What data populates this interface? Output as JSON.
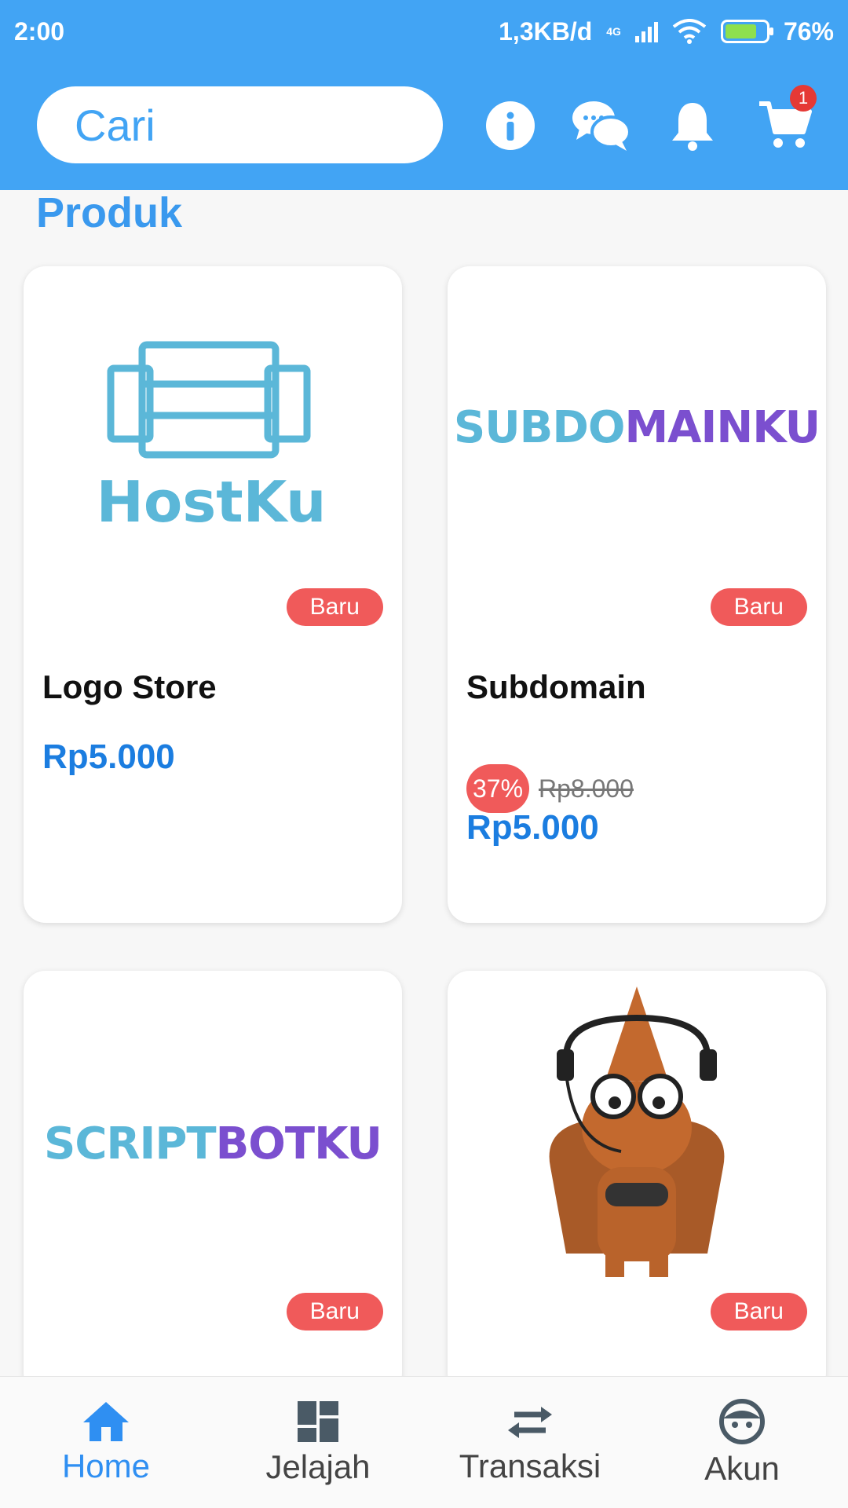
{
  "statusbar": {
    "time": "2:00",
    "speed": "1,3KB/d",
    "network": "4G",
    "battery": "76%"
  },
  "header": {
    "search_placeholder": "Cari",
    "cart_count": "1",
    "icons": [
      "info-icon",
      "chat-icon",
      "bell-icon",
      "cart-icon"
    ]
  },
  "section": {
    "title": "Produk"
  },
  "products": [
    {
      "name": "Logo Store",
      "price": "Rp5.000",
      "badge": "Baru",
      "logo_text": "HostKu"
    },
    {
      "name": "Subdomain",
      "price": "Rp5.000",
      "badge": "Baru",
      "discount": "37%",
      "old_price": "Rp8.000",
      "logo_text_a": "SUBDO",
      "logo_text_b": "MAINKU"
    },
    {
      "badge": "Baru",
      "logo_text_a": "SCRIPT",
      "logo_text_b": "BOTKU"
    },
    {
      "badge": "Baru"
    }
  ],
  "nav": [
    {
      "label": "Home",
      "active": true
    },
    {
      "label": "Jelajah"
    },
    {
      "label": "Transaksi"
    },
    {
      "label": "Akun"
    }
  ],
  "colors": {
    "primary": "#42a4f4",
    "price": "#1b7de0",
    "badge": "#f05a5a",
    "logo_blue": "#5bb7d8",
    "logo_purple": "#7b4fcf"
  }
}
